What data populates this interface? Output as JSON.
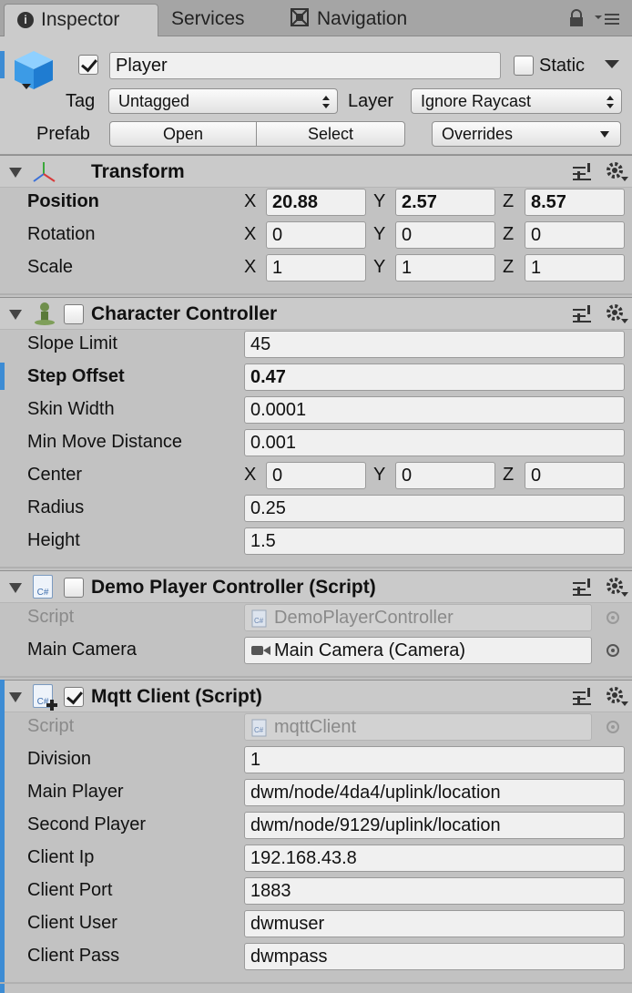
{
  "tabs": {
    "inspector": "Inspector",
    "services": "Services",
    "navigation": "Navigation"
  },
  "header": {
    "name": "Player",
    "enabled": true,
    "static_label": "Static",
    "tag_label": "Tag",
    "tag_value": "Untagged",
    "layer_label": "Layer",
    "layer_value": "Ignore Raycast",
    "prefab_label": "Prefab",
    "open_label": "Open",
    "select_label": "Select",
    "overrides_label": "Overrides"
  },
  "transform": {
    "title": "Transform",
    "rows": [
      {
        "label": "Position",
        "x": "20.88",
        "y": "2.57",
        "z": "8.57"
      },
      {
        "label": "Rotation",
        "x": "0",
        "y": "0",
        "z": "0"
      },
      {
        "label": "Scale",
        "x": "1",
        "y": "1",
        "z": "1"
      }
    ],
    "axis_x": "X",
    "axis_y": "Y",
    "axis_z": "Z"
  },
  "character_controller": {
    "title": "Character Controller",
    "enabled": false,
    "slope_limit_label": "Slope Limit",
    "slope_limit": "45",
    "step_offset_label": "Step Offset",
    "step_offset": "0.47",
    "skin_width_label": "Skin Width",
    "skin_width": "0.0001",
    "min_move_label": "Min Move Distance",
    "min_move": "0.001",
    "center_label": "Center",
    "center_x": "0",
    "center_y": "0",
    "center_z": "0",
    "radius_label": "Radius",
    "radius": "0.25",
    "height_label": "Height",
    "height": "1.5"
  },
  "demo_player": {
    "title": "Demo Player Controller (Script)",
    "enabled": false,
    "script_label": "Script",
    "script_value": "DemoPlayerController",
    "main_camera_label": "Main Camera",
    "main_camera_value": "Main Camera (Camera)"
  },
  "mqtt": {
    "title": "Mqtt Client (Script)",
    "enabled": true,
    "script_label": "Script",
    "script_value": "mqttClient",
    "division_label": "Division",
    "division": "1",
    "main_player_label": "Main Player",
    "main_player": "dwm/node/4da4/uplink/location",
    "second_player_label": "Second Player",
    "second_player": "dwm/node/9129/uplink/location",
    "client_ip_label": "Client Ip",
    "client_ip": "192.168.43.8",
    "client_port_label": "Client Port",
    "client_port": "1883",
    "client_user_label": "Client User",
    "client_user": "dwmuser",
    "client_pass_label": "Client Pass",
    "client_pass": "dwmpass"
  },
  "icons": {
    "cs_glyph": "C#"
  }
}
